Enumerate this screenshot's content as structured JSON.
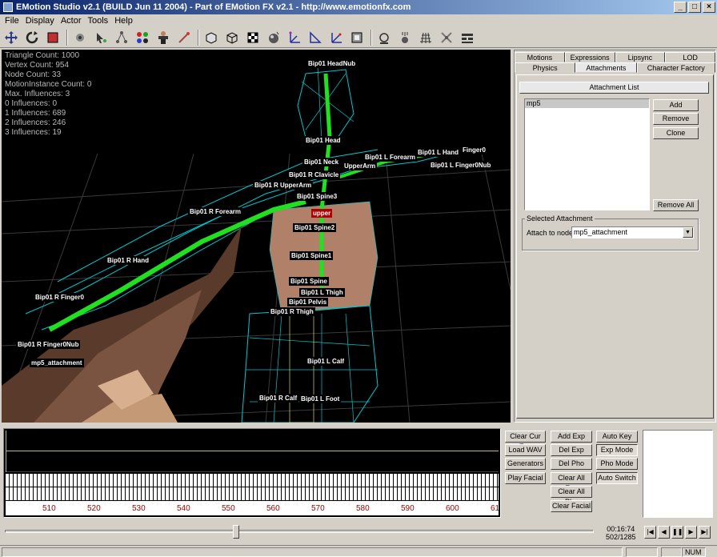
{
  "window": {
    "title": "EMotion Studio v2.1 (BUILD Jun 11 2004) - Part of EMotion FX v2.1 - http://www.emotionfx.com"
  },
  "menu": [
    "File",
    "Display",
    "Actor",
    "Tools",
    "Help"
  ],
  "toolbar_icons": [
    "move-icon",
    "rotate-icon",
    "scale-icon",
    "select-icon",
    "pointer-icon",
    "hierarchy-icon",
    "color-icon",
    "actor-icon",
    "bone-icon",
    "box-icon",
    "wireframe-box-icon",
    "checker-icon",
    "sphere-icon",
    "axis-icon",
    "normals-icon",
    "tangent-icon",
    "bounds-icon",
    "camera-icon",
    "light-icon",
    "grid-icon",
    "skeleton-icon",
    "layout-icon"
  ],
  "stats": [
    "Triangle Count: 1000",
    "Vertex Count: 954",
    "Node Count: 33",
    "MotionInstance Count: 0",
    "Max. Influences: 3",
    "0 Influences: 0",
    "1 Influences: 689",
    "2 Influences: 246",
    "3 Influences: 19"
  ],
  "nodes": [
    {
      "label": "Bip01 HeadNub",
      "red": false
    },
    {
      "label": "Bip01 Head",
      "red": false
    },
    {
      "label": "Bip01 L Hand",
      "red": false
    },
    {
      "label": "Finger0",
      "red": false
    },
    {
      "label": "Bip01 L Forearm",
      "red": false
    },
    {
      "label": "Bip01 L Finger0Nub",
      "red": false
    },
    {
      "label": "Bip01 Neck",
      "red": false
    },
    {
      "label": "UpperArm",
      "red": false
    },
    {
      "label": "Bip01 R Clavicle",
      "red": false
    },
    {
      "label": "Bip01 R UpperArm",
      "red": false
    },
    {
      "label": "Bip01 Spine3",
      "red": false
    },
    {
      "label": "Bip01 R Forearm",
      "red": false
    },
    {
      "label": "upper",
      "red": true
    },
    {
      "label": "Bip01 Spine2",
      "red": false
    },
    {
      "label": "Bip01 R Hand",
      "red": false
    },
    {
      "label": "Bip01 Spine1",
      "red": false
    },
    {
      "label": "Bip01 Spine",
      "red": false
    },
    {
      "label": "Bip01 L Thigh",
      "red": false
    },
    {
      "label": "Bip01 R Finger0",
      "red": false
    },
    {
      "label": "Bip01 Pelvis",
      "red": false
    },
    {
      "label": "Bip01 R Thigh",
      "red": false
    },
    {
      "label": "Bip01 R Finger0Nub",
      "red": false
    },
    {
      "label": "mp5_attachment",
      "red": false
    },
    {
      "label": "Bip01 L Calf",
      "red": false
    },
    {
      "label": "Bip01 R Calf",
      "red": false
    },
    {
      "label": "Bip01 L Foot",
      "red": false
    }
  ],
  "tabs": {
    "row1": [
      "Motions",
      "Expressions",
      "Lipsync",
      "LOD"
    ],
    "row2": [
      "Physics",
      "Attachments",
      "Character Factory"
    ],
    "active": "Attachments"
  },
  "attachments": {
    "list_title": "Attachment List",
    "items": [
      "mp5"
    ],
    "buttons": {
      "add": "Add",
      "remove": "Remove",
      "clone": "Clone",
      "remove_all": "Remove All"
    },
    "selected_group": "Selected Attachment",
    "attach_label": "Attach to node:",
    "attach_value": "mp5_attachment"
  },
  "facial_buttons": {
    "col1": [
      "Clear Cur Exp",
      "Load WAV",
      "Generators",
      "Play Facial"
    ],
    "col2": [
      "Add Exp",
      "Del Exp",
      "Del Pho",
      "Clear All Exp",
      "Clear All Pho",
      "Clear Facial"
    ],
    "col3": [
      "Auto Key",
      "Exp Mode",
      "Pho Mode",
      "Auto Switch"
    ]
  },
  "timeline": {
    "ticks": [
      "510",
      "520",
      "530",
      "540",
      "550",
      "560",
      "570",
      "580",
      "590",
      "600",
      "61"
    ]
  },
  "playback": {
    "time": "00:16:74",
    "frame": "502/1285",
    "position": 0.39,
    "buttons": [
      "first-icon",
      "prev-icon",
      "pause-icon",
      "next-icon",
      "last-icon"
    ]
  },
  "statusbar": {
    "num": "NUM"
  }
}
